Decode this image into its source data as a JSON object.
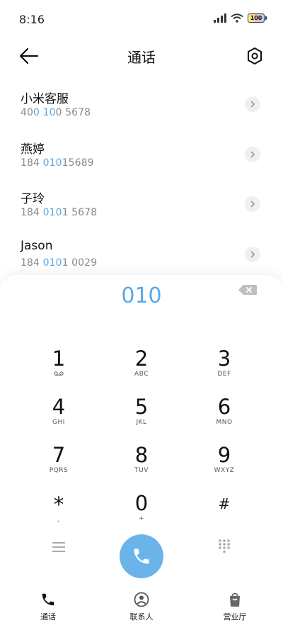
{
  "status": {
    "time": "8:16",
    "battery": "100"
  },
  "header": {
    "title": "通话"
  },
  "results": [
    {
      "name": "小米客服",
      "num_pre": "40",
      "num_hl": "0 10",
      "num_post": "0 5678"
    },
    {
      "name": "燕婷",
      "num_pre": "184 ",
      "num_hl": "010",
      "num_post": "15689"
    },
    {
      "name": "子玲",
      "num_pre": "184 ",
      "num_hl": "010",
      "num_post": "1 5678"
    },
    {
      "name": "Jason",
      "num_pre": "184 ",
      "num_hl": "010",
      "num_post": "1 0029"
    }
  ],
  "dialer": {
    "entered": "010",
    "keys": [
      {
        "digit": "1",
        "letters": ""
      },
      {
        "digit": "2",
        "letters": "ABC"
      },
      {
        "digit": "3",
        "letters": "DEF"
      },
      {
        "digit": "4",
        "letters": "GHI"
      },
      {
        "digit": "5",
        "letters": "JKL"
      },
      {
        "digit": "6",
        "letters": "MNO"
      },
      {
        "digit": "7",
        "letters": "PQRS"
      },
      {
        "digit": "8",
        "letters": "TUV"
      },
      {
        "digit": "9",
        "letters": "WXYZ"
      },
      {
        "digit": "*",
        "letters": ","
      },
      {
        "digit": "0",
        "letters": "+"
      },
      {
        "digit": "#",
        "letters": ""
      }
    ]
  },
  "tabs": [
    {
      "label": "通话"
    },
    {
      "label": "联系人"
    },
    {
      "label": "营业厅"
    }
  ],
  "colors": {
    "accent": "#5aa9e6",
    "call_button": "#6ab4ea"
  }
}
